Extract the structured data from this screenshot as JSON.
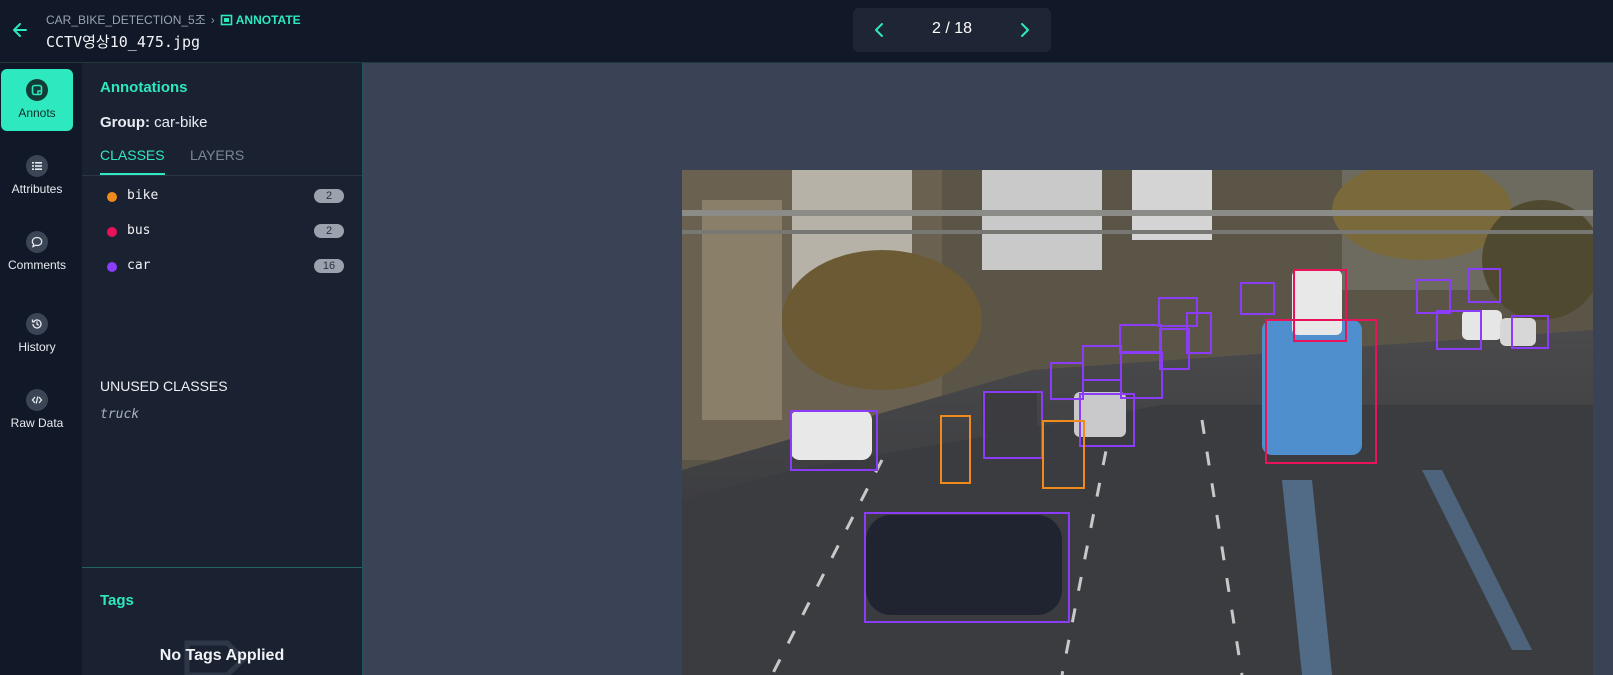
{
  "header": {
    "breadcrumb_project": "CAR_BIKE_DETECTION_5조",
    "breadcrumb_current": "ANNOTATE",
    "filename": "CCTV영상10_475.jpg",
    "pager": "2 / 18"
  },
  "nav": [
    {
      "label": "Annots",
      "icon": "annotation-icon",
      "active": true
    },
    {
      "label": "Attributes",
      "icon": "list-icon"
    },
    {
      "label": "Comments",
      "icon": "comment-icon"
    },
    {
      "label": "History",
      "icon": "history-icon"
    },
    {
      "label": "Raw Data",
      "icon": "code-icon"
    }
  ],
  "panel": {
    "title": "Annotations",
    "group_label": "Group:",
    "group_value": "car-bike",
    "tab_classes": "CLASSES",
    "tab_layers": "LAYERS",
    "classes": [
      {
        "name": "bike",
        "count": "2",
        "color": "#f08a1c"
      },
      {
        "name": "bus",
        "count": "2",
        "color": "#e8135a"
      },
      {
        "name": "car",
        "count": "16",
        "color": "#8b3cf7"
      }
    ],
    "unused_title": "UNUSED CLASSES",
    "unused": [
      "truck"
    ],
    "tags_title": "Tags",
    "tags_empty": "No Tags Applied"
  },
  "colors": {
    "accent": "#2ee8bf",
    "bike": "#f08a1c",
    "bus": "#e8135a",
    "car": "#8b3cf7"
  }
}
